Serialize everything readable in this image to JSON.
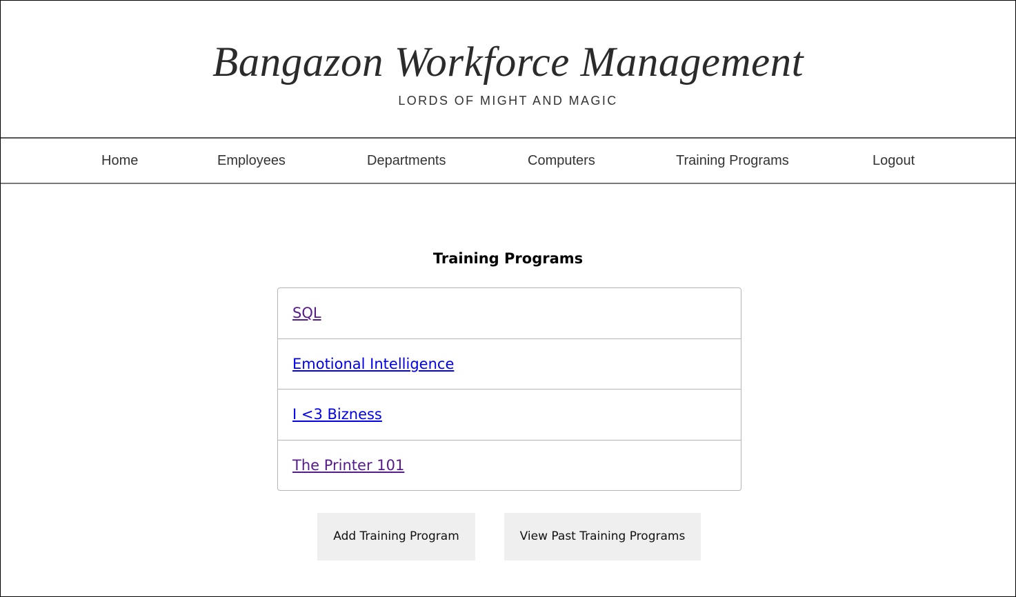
{
  "header": {
    "title": "Bangazon Workforce Management",
    "subtitle": "LORDS OF MIGHT AND MAGIC"
  },
  "nav": {
    "items": [
      {
        "label": "Home"
      },
      {
        "label": "Employees"
      },
      {
        "label": "Departments"
      },
      {
        "label": "Computers"
      },
      {
        "label": "Training Programs"
      },
      {
        "label": "Logout"
      }
    ]
  },
  "main": {
    "title": "Training Programs",
    "programs": [
      {
        "name": "SQL",
        "visited": true
      },
      {
        "name": "Emotional Intelligence",
        "visited": false
      },
      {
        "name": "I <3 Bizness",
        "visited": false
      },
      {
        "name": "The Printer 101",
        "visited": true
      }
    ],
    "buttons": {
      "add_label": "Add Training Program",
      "past_label": "View Past Training Programs"
    }
  },
  "colors": {
    "link_unvisited": "#0000ee",
    "link_visited": "#551a8b",
    "button_bg": "#efefef",
    "title_text": "#2b2b2b"
  }
}
